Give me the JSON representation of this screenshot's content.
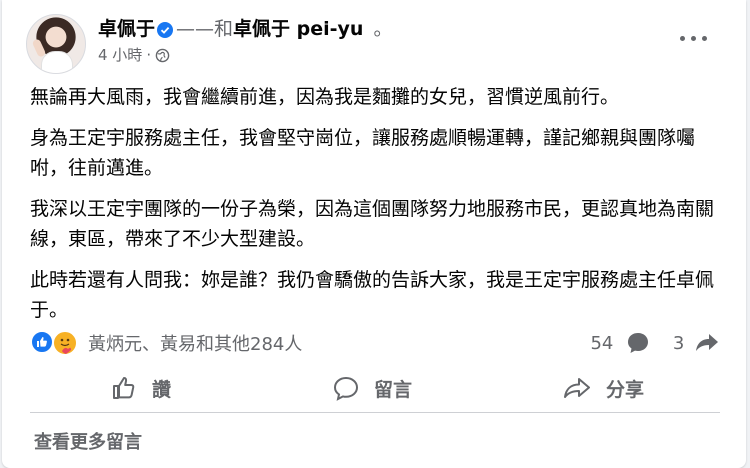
{
  "post": {
    "author": "卓佩于",
    "with_text": "——和",
    "with_name": "卓佩于 pei-yu",
    "end_mark": "。",
    "time": "4 小時",
    "dot": "·",
    "paragraphs": [
      "無論再大風雨，我會繼續前進，因為我是麵攤的女兒，習慣逆風前行。",
      "身為王定宇服務處主任，我會堅守崗位，讓服務處順暢運轉，謹記鄉親與團隊囑咐，往前邁進。",
      "我深以王定宇團隊的一份子為榮，因為這個團隊努力地服務市民，更認真地為南關線，東區，帶來了不少大型建設。",
      "此時若還有人問我：妳是誰？我仍會驕傲的告訴大家，我是王定宇服務處主任卓佩于。"
    ]
  },
  "reactions": {
    "names": "黃炳元、黃易和其他284人",
    "comments_count": "54",
    "shares_count": "3"
  },
  "actions": {
    "like": "讚",
    "comment": "留言",
    "share": "分享"
  },
  "footer": {
    "more_comments": "查看更多留言"
  },
  "colors": {
    "brand_blue": "#1877f2",
    "secondary_text": "#65676b",
    "care_yellow": "#f7b125"
  }
}
